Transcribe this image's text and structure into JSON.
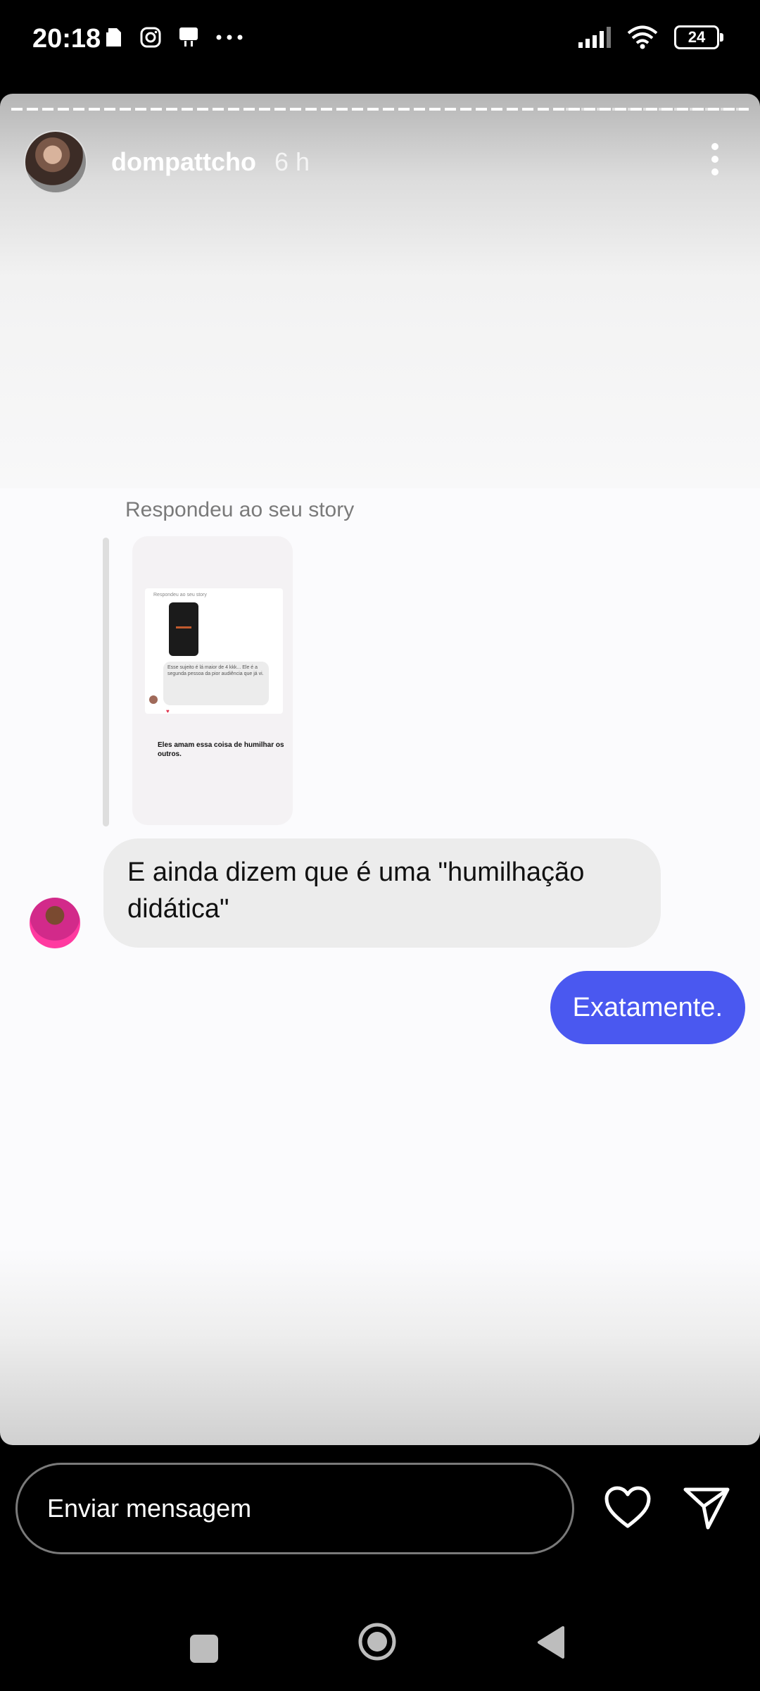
{
  "status_bar": {
    "time": "20:18",
    "left_icons": [
      "sim-icon",
      "instagram-icon",
      "notification-icon",
      "more-dots-icon"
    ],
    "right_icons": [
      "signal-icon",
      "wifi-icon",
      "battery-icon"
    ],
    "battery": "24"
  },
  "story": {
    "username": "dompattcho",
    "time": "6 h",
    "reply_caption": "Respondeu ao seu story",
    "thumbnail": {
      "caption": "Respondeu ao seu story",
      "bubble_text": "Esse sujeito é lá maior de 4 kkk... Ele é a segunda pessoa da pior audiência que já vi.",
      "bottom_text": "Eles amam essa coisa de humilhar os outros."
    }
  },
  "messages": [
    {
      "direction": "received",
      "text": "E ainda dizem que é uma \"humilhação didática\""
    },
    {
      "direction": "sent",
      "text": "Exatamente."
    }
  ],
  "composer": {
    "placeholder": "Enviar mensagem"
  },
  "colors": {
    "sent_bubble": "#4a58f0",
    "received_bubble": "#ececec",
    "background": "#000000"
  }
}
